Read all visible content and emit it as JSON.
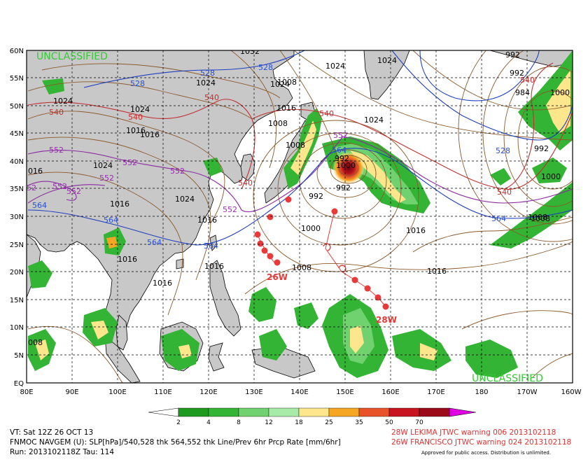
{
  "classification": {
    "top": "UNCLASSIFIED",
    "bottom": "UNCLASSIFIED"
  },
  "latitude_labels": [
    "60N",
    "55N",
    "50N",
    "45N",
    "40N",
    "35N",
    "30N",
    "25N",
    "20N",
    "15N",
    "10N",
    "5N",
    "EQ"
  ],
  "longitude_labels": [
    "80E",
    "90E",
    "100E",
    "110E",
    "120E",
    "130E",
    "140E",
    "150E",
    "160E",
    "170E",
    "180",
    "170W",
    "160W"
  ],
  "pressure_labels": [
    {
      "t": "1032"
    },
    {
      "t": "1024"
    },
    {
      "t": "1024"
    },
    {
      "t": "1024"
    },
    {
      "t": "1024"
    },
    {
      "t": "1024"
    },
    {
      "t": "1016"
    },
    {
      "t": "1016"
    },
    {
      "t": "1016"
    },
    {
      "t": "1016"
    },
    {
      "t": "1016"
    },
    {
      "t": "1016"
    },
    {
      "t": "1016"
    },
    {
      "t": "1016"
    },
    {
      "t": "1016"
    },
    {
      "t": "1024"
    },
    {
      "t": "1024"
    },
    {
      "t": "1024"
    },
    {
      "t": "1008"
    },
    {
      "t": "1008"
    },
    {
      "t": "1008"
    },
    {
      "t": "1008"
    },
    {
      "t": "1000"
    },
    {
      "t": "992"
    },
    {
      "t": "992"
    },
    {
      "t": "992"
    },
    {
      "t": "992"
    },
    {
      "t": "984"
    },
    {
      "t": "1000"
    },
    {
      "t": "1000"
    },
    {
      "t": "992"
    },
    {
      "t": "1000"
    },
    {
      "t": "1008"
    },
    {
      "t": "992"
    },
    {
      "t": "1008"
    },
    {
      "t": "016"
    },
    {
      "t": "008"
    },
    {
      "t": "1024"
    },
    {
      "t": "1016"
    }
  ],
  "thickness_540_labels": [
    {
      "t": "540"
    },
    {
      "t": "540"
    },
    {
      "t": "540"
    },
    {
      "t": "540"
    },
    {
      "t": "540"
    },
    {
      "t": "540"
    },
    {
      "t": "540"
    }
  ],
  "thickness_552_labels": [
    {
      "t": "552"
    },
    {
      "t": "552"
    },
    {
      "t": "552"
    },
    {
      "t": "552"
    },
    {
      "t": "552"
    },
    {
      "t": "552"
    },
    {
      "t": "552"
    },
    {
      "t": "552"
    },
    {
      "t": "52"
    }
  ],
  "thickness_blue_labels": [
    {
      "t": "528"
    },
    {
      "t": "528"
    },
    {
      "t": "528"
    },
    {
      "t": "564"
    },
    {
      "t": "564"
    },
    {
      "t": "564"
    },
    {
      "t": "564"
    },
    {
      "t": "564"
    },
    {
      "t": "528"
    },
    {
      "t": "564"
    }
  ],
  "storm_labels": [
    "28W",
    "26W"
  ],
  "colorbar": {
    "ticks": [
      "2",
      "4",
      "8",
      "12",
      "18",
      "25",
      "35",
      "50",
      "70"
    ],
    "colors": [
      "#1e9a1e",
      "#34b434",
      "#6fd26f",
      "#a8eba8",
      "#fde68c",
      "#f5a623",
      "#e8542a",
      "#c8141e",
      "#9a0a18",
      "#e100e1"
    ]
  },
  "footer": {
    "vt": "VT: Sat 12Z 26 OCT 13",
    "model": "FNMOC NAVGEM (U): SLP[hPa]/540,528 thk 564,552 thk Line/Prev 6hr Prcp Rate [mm/6hr]",
    "run": "Run: 2013102118Z Tau: 114",
    "warning1": "28W LEKIMA JTWC warning 006 2013102118",
    "warning2": "26W FRANCISCO JTWC warning 024 2013102118",
    "approved": "Approved for public access. Distribution is unlimited."
  }
}
